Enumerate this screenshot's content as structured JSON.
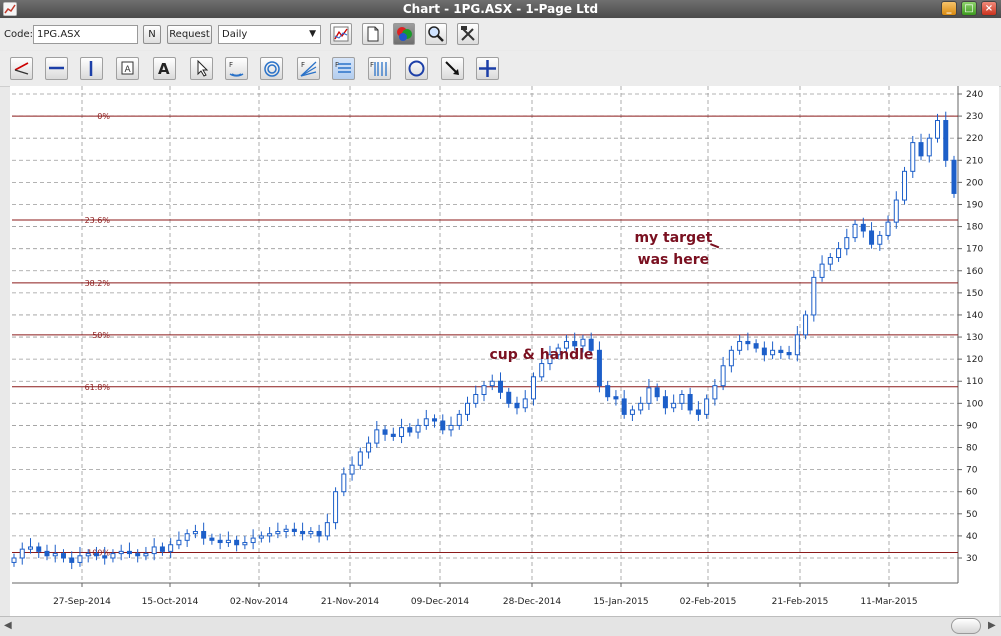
{
  "window": {
    "title": "Chart - 1PG.ASX - 1-Page Ltd"
  },
  "toolbar": {
    "code_label": "Code:",
    "code_value": "1PG.ASX",
    "n_label": "N",
    "request_label": "Request",
    "period_value": "Daily",
    "icons": [
      "chart-style-icon",
      "new-page-icon",
      "colors-icon",
      "zoom-icon",
      "tools-icon"
    ]
  },
  "drawing_tools": [
    "trend-line-icon",
    "horizontal-line-icon",
    "vertical-line-icon",
    "text-box-icon",
    "text-icon",
    "cursor-icon",
    "fibonacci-arcs-icon",
    "fibonacci-circles-icon",
    "fibonacci-fan-icon",
    "fibonacci-retracement-icon",
    "fibonacci-timezones-icon",
    "ellipse-icon",
    "arrow-icon",
    "crosshair-icon"
  ],
  "chart_data": {
    "type": "candlestick",
    "y_axis": {
      "min": 20,
      "max": 240,
      "step": 10,
      "ticks": [
        240,
        230,
        220,
        210,
        200,
        190,
        180,
        170,
        160,
        150,
        140,
        130,
        120,
        110,
        100,
        90,
        80,
        70,
        60,
        50,
        40,
        30
      ]
    },
    "x_labels": [
      "27-Sep-2014",
      "15-Oct-2014",
      "02-Nov-2014",
      "21-Nov-2014",
      "09-Dec-2014",
      "28-Dec-2014",
      "15-Jan-2015",
      "02-Feb-2015",
      "21-Feb-2015",
      "11-Mar-2015"
    ],
    "grid": true,
    "fibonacci": [
      {
        "label": "0%",
        "value": 230
      },
      {
        "label": "23.6%",
        "value": 183
      },
      {
        "label": "38.2%",
        "value": 154.5
      },
      {
        "label": "50%",
        "value": 131
      },
      {
        "label": "61.8%",
        "value": 107.5
      },
      {
        "label": "100%",
        "value": 32.5
      }
    ],
    "annotations": [
      {
        "text": "my target",
        "x_index": 83,
        "value": 173
      },
      {
        "text": "was here",
        "x_index": 83,
        "value": 163
      },
      {
        "text": "cup & handle",
        "x_index": 67,
        "value": 120
      }
    ],
    "closes": [
      30,
      34,
      35,
      33,
      31,
      32,
      30,
      28,
      31,
      32,
      31,
      30,
      32,
      33,
      32,
      31,
      32,
      35,
      33,
      36,
      38,
      41,
      42,
      39,
      38,
      37,
      38,
      36,
      37,
      39,
      40,
      41,
      42,
      43,
      42,
      41,
      42,
      40,
      46,
      60,
      68,
      72,
      78,
      82,
      88,
      86,
      85,
      89,
      87,
      90,
      93,
      92,
      88,
      90,
      95,
      100,
      104,
      108,
      110,
      105,
      100,
      98,
      102,
      112,
      118,
      122,
      125,
      128,
      126,
      129,
      124,
      108,
      103,
      102,
      95,
      97,
      100,
      107,
      103,
      98,
      100,
      104,
      97,
      95,
      102,
      108,
      117,
      124,
      128,
      127,
      125,
      122,
      124,
      123,
      122,
      131,
      140,
      157,
      163,
      166,
      170,
      175,
      181,
      178,
      172,
      176,
      182,
      192,
      205,
      218,
      212,
      220,
      228,
      210,
      195
    ]
  }
}
